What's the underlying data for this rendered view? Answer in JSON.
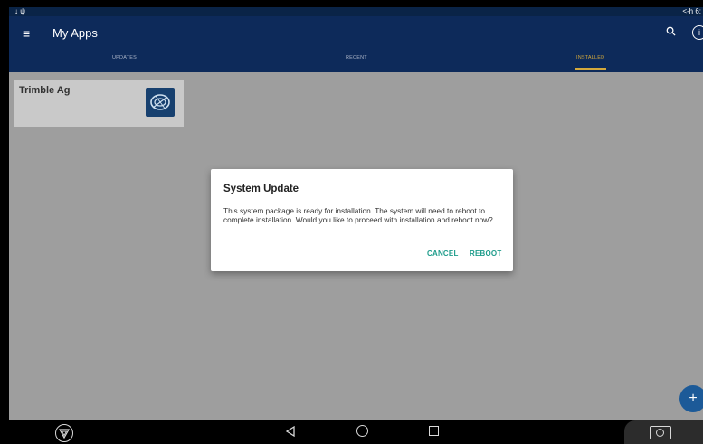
{
  "status_bar": {
    "left_icons": "↓ ψ",
    "right_text": "<-h 6:"
  },
  "app_bar": {
    "title": "My Apps"
  },
  "tabs": [
    {
      "label": "UPDATES"
    },
    {
      "label": "RECENT"
    },
    {
      "label": "INSTALLED",
      "active": true
    }
  ],
  "apps": [
    {
      "name": "Trimble Ag"
    }
  ],
  "dialog": {
    "title": "System Update",
    "body": "This system package is ready for installation. The system will need to reboot to complete installation. Would you like to proceed with installation and reboot now?",
    "cancel_label": "CANCEL",
    "reboot_label": "REBOOT"
  },
  "fab": {
    "label": "+"
  },
  "colors": {
    "app_bar": "#0d2a5a",
    "tab_active": "#d4a93c",
    "dialog_button": "#1e9c8b",
    "content_bg": "#9e9e9e",
    "fab": "#1c5a98"
  },
  "icons": [
    "menu-icon",
    "search-icon",
    "info-icon",
    "trimble-logo-icon",
    "back-icon",
    "home-icon",
    "recents-icon",
    "camera-icon"
  ]
}
